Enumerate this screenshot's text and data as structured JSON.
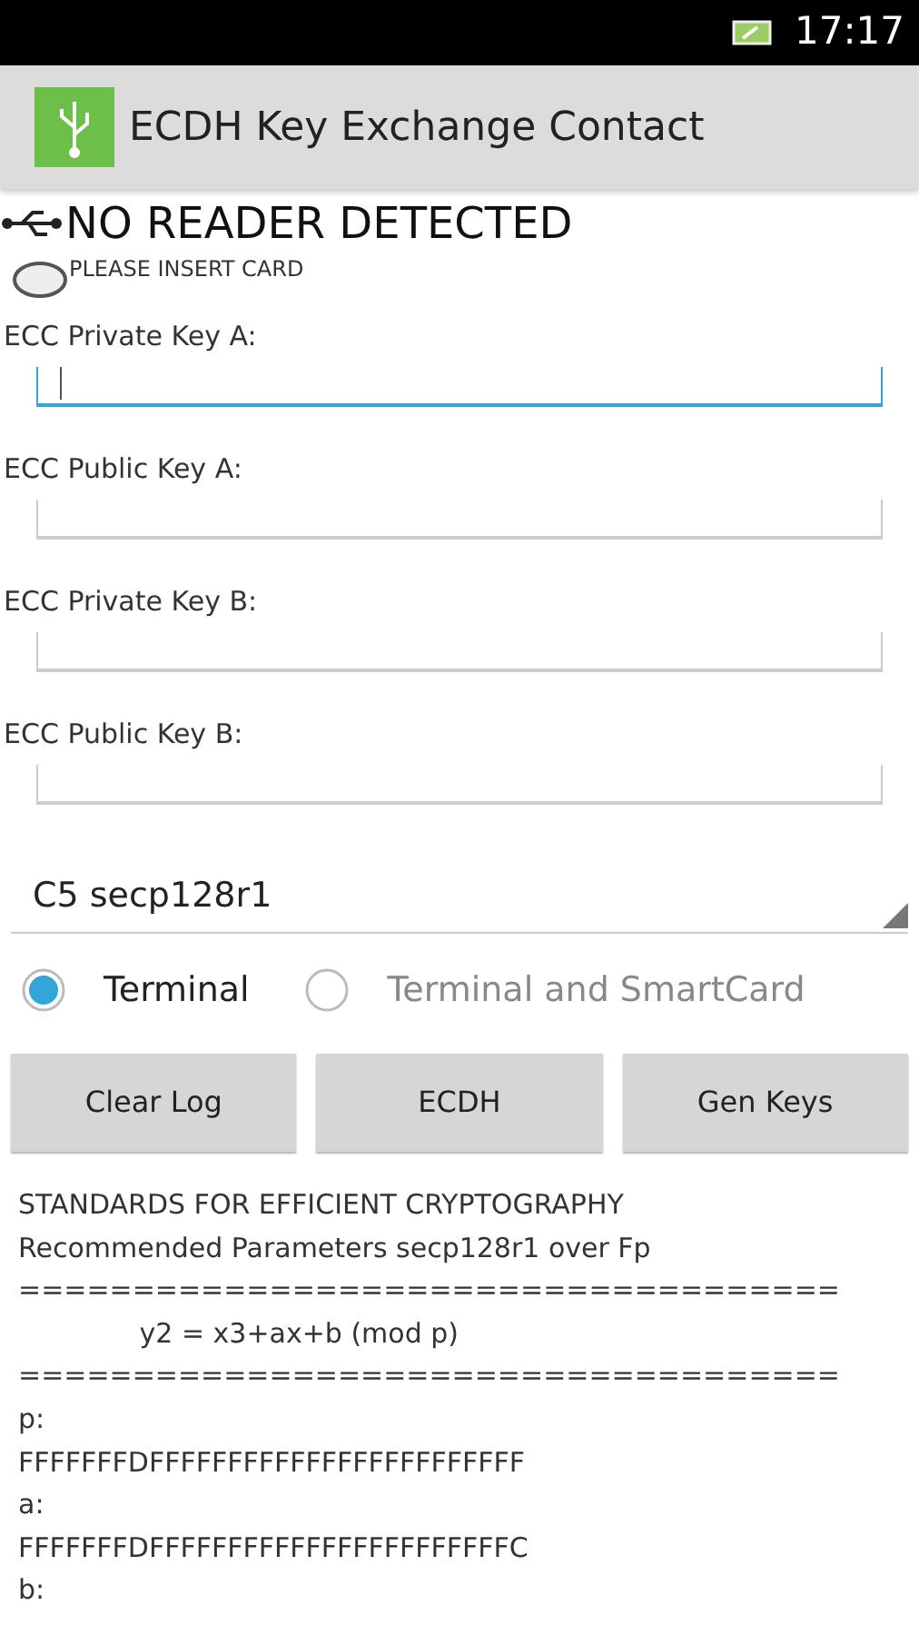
{
  "status_bar": {
    "time": "17:17"
  },
  "action_bar": {
    "title": "ECDH Key Exchange Contact"
  },
  "reader": {
    "status": "NO READER DETECTED",
    "hint": "PLEASE INSERT CARD"
  },
  "fields": [
    {
      "label": "ECC Private Key A:",
      "focused": true
    },
    {
      "label": "ECC Public Key A:",
      "focused": false
    },
    {
      "label": "ECC Private Key B:",
      "focused": false
    },
    {
      "label": "ECC Public Key B:",
      "focused": false
    }
  ],
  "curve_select": {
    "value": "C5 secp128r1"
  },
  "mode": [
    {
      "label": "Terminal",
      "selected": true
    },
    {
      "label": "Terminal and SmartCard",
      "selected": false
    }
  ],
  "buttons": [
    "Clear Log",
    "ECDH",
    "Gen Keys"
  ],
  "log": [
    "STANDARDS FOR EFFICIENT CRYPTOGRAPHY",
    "Recommended Parameters secp128r1 over Fp",
    "====================================",
    "              y2 = x3+ax+b (mod p)",
    "====================================",
    "p:",
    "FFFFFFFDFFFFFFFFFFFFFFFFFFFFFFFF",
    "a:",
    "FFFFFFFDFFFFFFFFFFFFFFFFFFFFFFFC",
    "b:"
  ]
}
